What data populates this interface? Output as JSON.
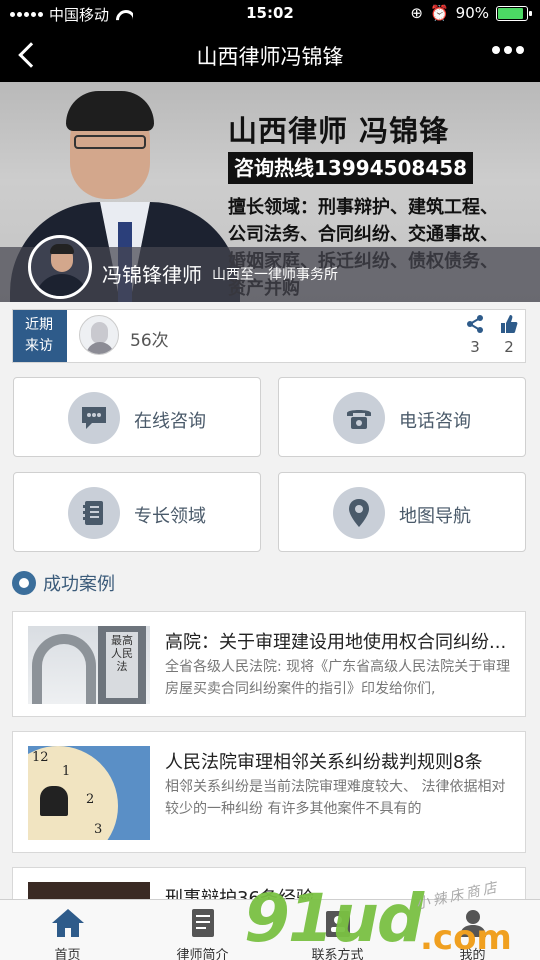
{
  "status_bar": {
    "carrier": "中国移动",
    "time": "15:02",
    "battery": "90%"
  },
  "nav": {
    "title": "山西律师冯锦锋"
  },
  "banner": {
    "headline": "山西律师 冯锦锋",
    "hotline": "咨询热线13994508458",
    "specialty": "擅长领域：刑事辩护、建筑工程、公司法务、合同纠纷、交通事故、婚姻家庭、拆迁纠纷、债权债务、资产并购"
  },
  "profile": {
    "name": "冯锦锋律师",
    "firm": "山西至一律师事务所"
  },
  "visits": {
    "tag_line1": "近期",
    "tag_line2": "来访",
    "count": "56次",
    "shares": "3",
    "likes": "2"
  },
  "actions": [
    {
      "label": "在线咨询",
      "icon": "chat-icon"
    },
    {
      "label": "电话咨询",
      "icon": "phone-icon"
    },
    {
      "label": "专长领域",
      "icon": "book-icon"
    },
    {
      "label": "地图导航",
      "icon": "map-pin-icon"
    }
  ],
  "cases_section": {
    "title": "成功案例"
  },
  "cases": [
    {
      "title": "高院：关于审理建设用地使用权合同纠纷...",
      "desc": "全省各级人民法院: 现将《广东省高级人民法院关于审理房屋买卖合同纠纷案件的指引》印发给你们,",
      "thumb_text": "最高人民法"
    },
    {
      "title": "人民法院审理相邻关系纠纷裁判规则8条",
      "desc": "相邻关系纠纷是当前法院审理难度较大、 法律依据相对较少的一种纠纷 有许多其他案件不具有的",
      "clock_nums": [
        "12",
        "1",
        "2",
        "3"
      ]
    },
    {
      "title": "刑事辩护36条经验",
      "desc": ""
    }
  ],
  "tabs": [
    {
      "label": "首页",
      "icon": "home-icon"
    },
    {
      "label": "律师简介",
      "icon": "document-icon"
    },
    {
      "label": "联系方式",
      "icon": "contact-icon"
    },
    {
      "label": "我的",
      "icon": "user-icon"
    }
  ],
  "watermark": {
    "main": "91ud",
    "suffix": ".com",
    "shop": "小辣床商店"
  },
  "colors": {
    "accent": "#2e5b8a",
    "icon_bg": "#c9cfd8",
    "section_title": "#3b5b7a",
    "watermark_green": "#7ac143"
  }
}
